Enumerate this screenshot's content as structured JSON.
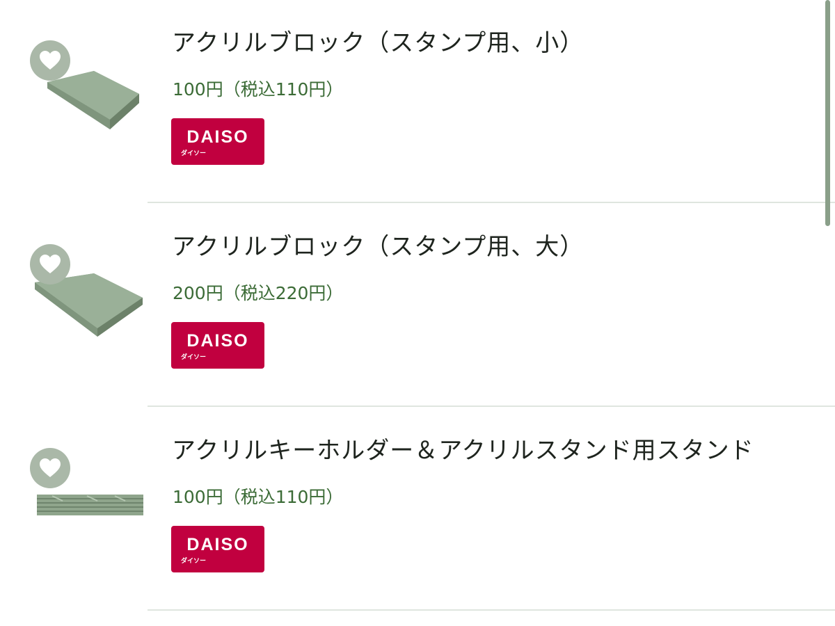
{
  "products": [
    {
      "name": "アクリルブロック（スタンプ用、小）",
      "price": "100円（税込110円）",
      "brand": "DAISO",
      "brand_kana": "ダイソー",
      "thumb_icon": "acrylic-block-small"
    },
    {
      "name": "アクリルブロック（スタンプ用、大）",
      "price": "200円（税込220円）",
      "brand": "DAISO",
      "brand_kana": "ダイソー",
      "thumb_icon": "acrylic-block-large"
    },
    {
      "name": "アクリルキーホルダー＆アクリルスタンド用スタンド",
      "price": "100円（税込110円）",
      "brand": "DAISO",
      "brand_kana": "ダイソー",
      "thumb_icon": "acrylic-stand-stack"
    }
  ],
  "colors": {
    "accent_green": "#3b6b36",
    "thumb_green": "#8fa58c",
    "brand_red": "#c1003f",
    "fav_circle": "#aab8a8"
  }
}
